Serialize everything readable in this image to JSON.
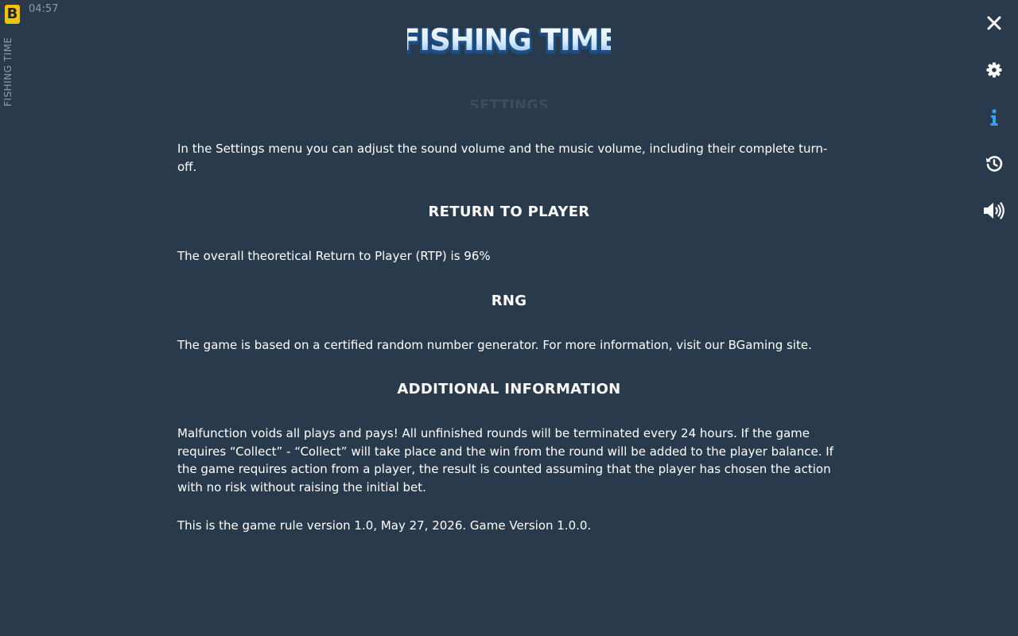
{
  "header": {
    "brand_letter": "B",
    "clock": "04:57",
    "side_title": "FISHING TIME",
    "logo_text": "FISHING TIME"
  },
  "controls": {
    "close_icon": "close-icon",
    "settings_icon": "gear-icon",
    "info_icon": "info-icon",
    "history_icon": "history-icon",
    "sound_icon": "speaker-icon"
  },
  "rules": {
    "settings_heading": "SETTINGS",
    "settings_text": "In the Settings menu you can adjust the sound volume and the music volume, including their complete turn-off.",
    "rtp_heading": "RETURN TO PLAYER",
    "rtp_text": "The overall theoretical Return to Player (RTP) is 96%",
    "rng_heading": "RNG",
    "rng_text": "The game is based on a certified random number generator. For more information, visit our BGaming site.",
    "additional_heading": "ADDITIONAL INFORMATION",
    "additional_text": "Malfunction voids all plays and pays! All unfinished rounds will be terminated every 24 hours. If the game requires “Collect” - “Collect” will take place and the win from the round will be added to the player balance. If the game requires action from a player, the result is counted assuming that the player has chosen the action with no risk without raising the initial bet.",
    "version_text": "This is the game rule version 1.0, May 27, 2026. Game Version 1.0.0."
  },
  "colors": {
    "background": "#2a3a4d",
    "accent": "#3b9cff",
    "brand": "#f5c400"
  }
}
